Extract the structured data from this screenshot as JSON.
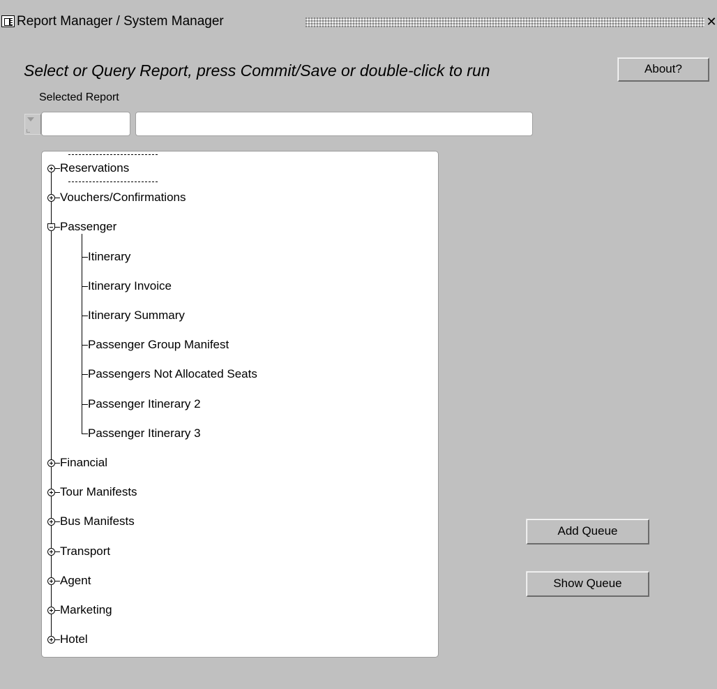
{
  "window": {
    "title": "Report Manager / System Manager",
    "close_glyph": "✕",
    "app_icon": "forms-app-icon"
  },
  "header": {
    "prompt": "Select or Query Report, press Commit/Save or double-click to run",
    "about_label": "About?",
    "selected_report_label": "Selected Report",
    "selected_report_code": "",
    "selected_report_name": ""
  },
  "tree": {
    "nodes": [
      {
        "label": "Reservations",
        "expanded": false,
        "focused": true
      },
      {
        "label": "Vouchers/Confirmations",
        "expanded": false
      },
      {
        "label": "Passenger",
        "expanded": true,
        "children": [
          "Itinerary",
          "Itinerary Invoice",
          "Itinerary Summary",
          "Passenger Group Manifest",
          "Passengers Not Allocated Seats",
          "Passenger Itinerary 2",
          "Passenger Itinerary 3"
        ]
      },
      {
        "label": "Financial",
        "expanded": false
      },
      {
        "label": "Tour Manifests",
        "expanded": false
      },
      {
        "label": "Bus Manifests",
        "expanded": false
      },
      {
        "label": "Transport",
        "expanded": false
      },
      {
        "label": "Agent",
        "expanded": false
      },
      {
        "label": "Marketing",
        "expanded": false
      },
      {
        "label": "Hotel",
        "expanded": false
      }
    ]
  },
  "actions": {
    "add_queue_label": "Add Queue",
    "show_queue_label": "Show Queue"
  },
  "colors": {
    "window_bg": "#c0c0c0",
    "tree_bg": "#ffffff"
  }
}
